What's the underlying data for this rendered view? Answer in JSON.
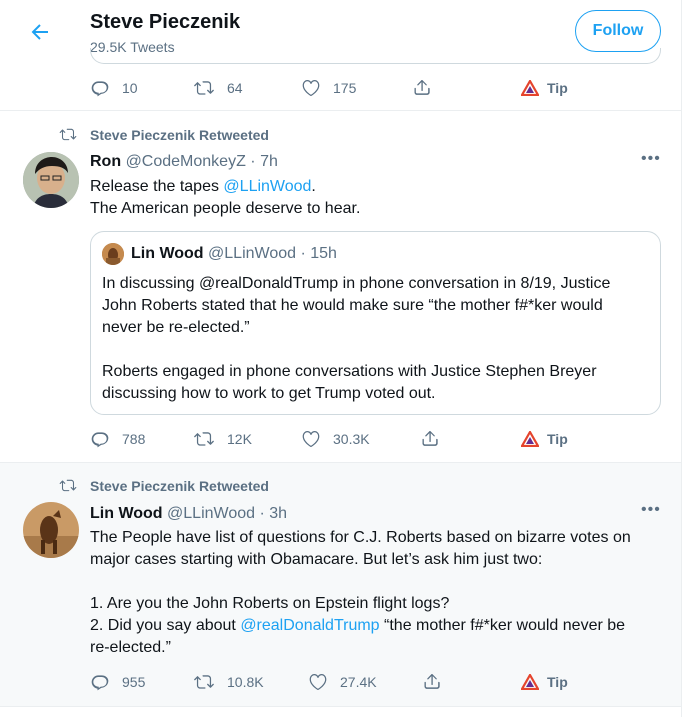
{
  "header": {
    "title": "Steve Pieczenik",
    "subtitle": "29.5K Tweets",
    "follow_label": "Follow"
  },
  "tweet0": {
    "reply_count": "10",
    "retweet_count": "64",
    "like_count": "175",
    "tip_label": "Tip"
  },
  "tweet1": {
    "retweeted_by": "Steve Pieczenik Retweeted",
    "name": "Ron",
    "handle_time": "@CodeMonkeyZ · 7h",
    "line1_prefix": "Release the tapes ",
    "line1_mention": "@LLinWood",
    "line1_suffix": ".",
    "line2": "The American people deserve to hear.",
    "quote": {
      "name": "Lin Wood",
      "handle_time": "@LLinWood · 15h",
      "lines": [
        "In discussing @realDonaldTrump in phone conversation in 8/19, Justice",
        "John Roberts stated that he would make sure “the mother f#*ker would",
        "never be re-elected.”",
        "Roberts engaged in phone conversations with Justice Stephen Breyer",
        "discussing how to work to get Trump voted out."
      ]
    },
    "reply_count": "788",
    "retweet_count": "12K",
    "like_count": "30.3K",
    "tip_label": "Tip"
  },
  "tweet2": {
    "retweeted_by": "Steve Pieczenik Retweeted",
    "name": "Lin Wood",
    "handle_time": "@LLinWood · 3h",
    "lines": [
      "The People have list of questions for C.J. Roberts based on bizarre votes on",
      "major cases starting with Obamacare. But let’s ask him just two:",
      "1. Are you the John Roberts on Epstein flight logs?"
    ],
    "line4_prefix": "2. Did you say about ",
    "line4_mention": "@realDonaldTrump",
    "line4_suffix": " “the mother f#*ker would never be",
    "line5": "re-elected.”",
    "reply_count": "955",
    "retweet_count": "10.8K",
    "like_count": "27.4K",
    "tip_label": "Tip"
  },
  "colors": {
    "accent": "#1da1f2",
    "secondary_text": "#5b7083",
    "tip_brave": "#e5442d"
  }
}
